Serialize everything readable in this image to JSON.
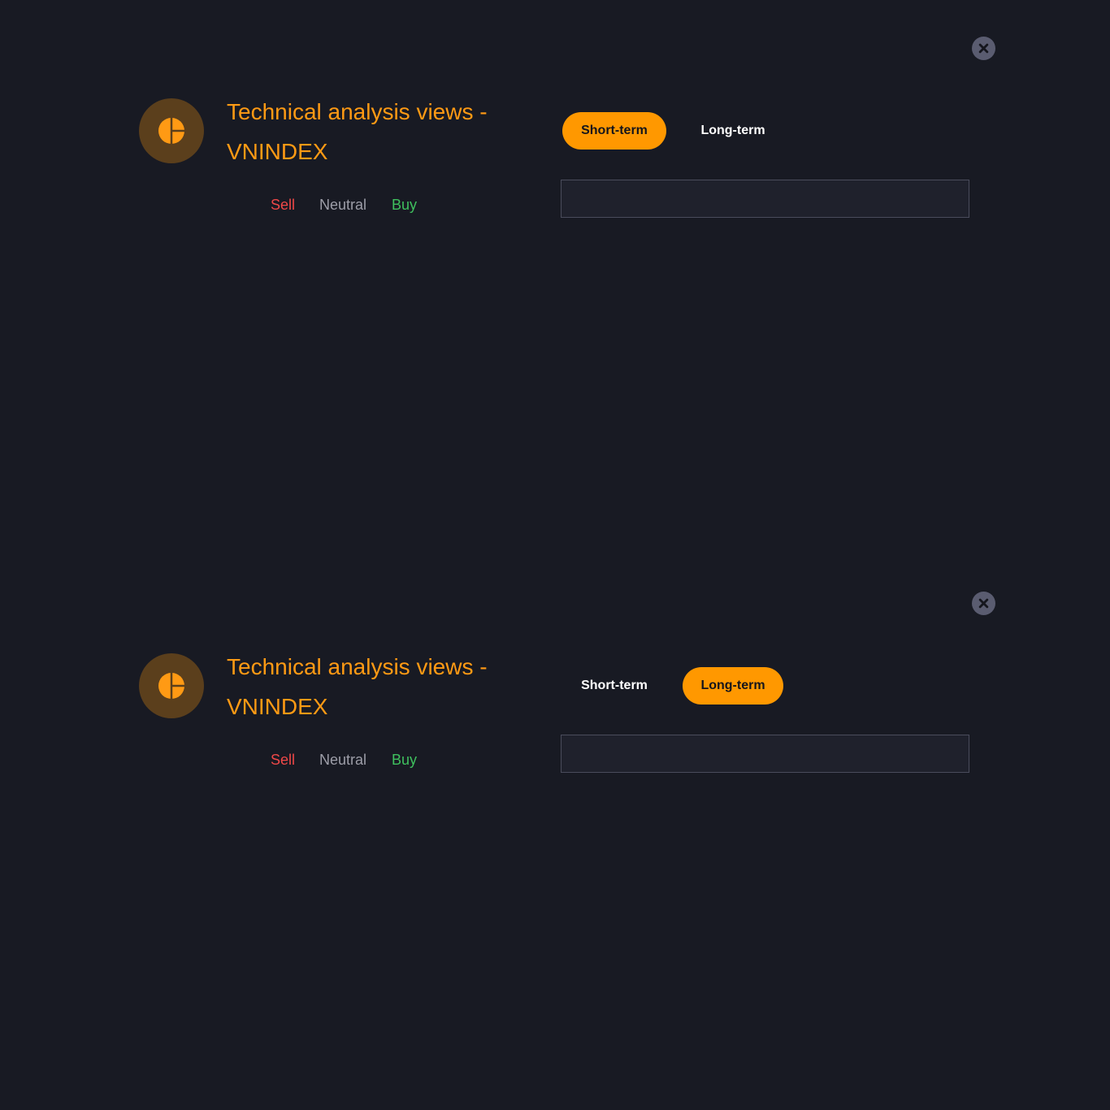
{
  "colors": {
    "background": "#181a23",
    "accent": "#ff9800",
    "title": "#ff9a14",
    "sell": "#f04848",
    "neutral": "#9d9ea8",
    "buy": "#3fc05e",
    "close_button_bg": "#5a5c70"
  },
  "panels": [
    {
      "title": "Technical analysis views - VNINDEX",
      "icon": "pie-chart-icon",
      "close_icon": "close-icon",
      "legend": {
        "sell": "Sell",
        "neutral": "Neutral",
        "buy": "Buy"
      },
      "tabs": [
        {
          "label": "Short-term",
          "active": true
        },
        {
          "label": "Long-term",
          "active": false
        }
      ]
    },
    {
      "title": "Technical analysis views - VNINDEX",
      "icon": "pie-chart-icon",
      "close_icon": "close-icon",
      "legend": {
        "sell": "Sell",
        "neutral": "Neutral",
        "buy": "Buy"
      },
      "tabs": [
        {
          "label": "Short-term",
          "active": false
        },
        {
          "label": "Long-term",
          "active": true
        }
      ]
    }
  ]
}
